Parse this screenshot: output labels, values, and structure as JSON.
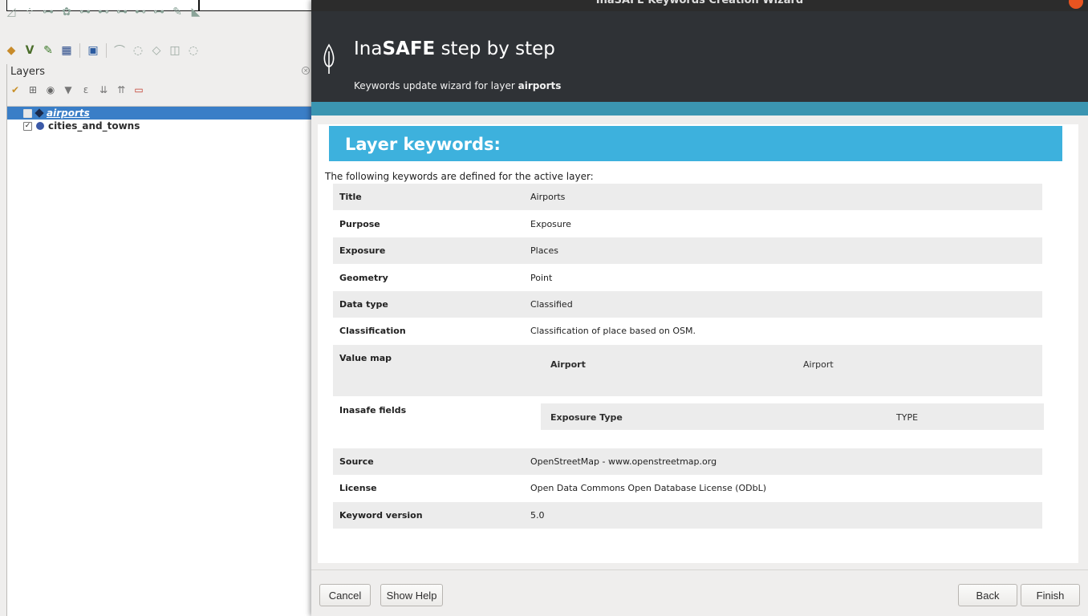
{
  "qgis": {
    "layers_panel": {
      "title": "Layers",
      "layers": [
        {
          "name": "airports",
          "checked": false,
          "selected": true,
          "symbol": "point-diamond"
        },
        {
          "name": "cities_and_towns",
          "checked": true,
          "selected": false,
          "symbol": "point-circle"
        }
      ]
    },
    "toolbar_row1_icons": [
      "digitize-icon",
      "node-tool-icon",
      "add-feature-icon",
      "vertex-icon",
      "move-icon",
      "rotate-icon",
      "split-icon",
      "merge-icon",
      "reshape-icon",
      "offset-icon",
      "edit-icon"
    ],
    "toolbar_row2_icons": [
      "layer-style-icon",
      "vertex-tool-icon",
      "pen-icon",
      "plugin-icon",
      "processing-icon",
      "curve-icon",
      "bezier-icon",
      "shape-icon",
      "select-icon",
      "extra-icon"
    ]
  },
  "dialog": {
    "window_title": "InaSAFE Keywords Creation Wizard",
    "header": {
      "title_prefix": "Ina",
      "title_bold": "SAFE",
      "title_suffix": " step by step",
      "subtitle_prefix": "Keywords update wizard for layer ",
      "subtitle_layer": "airports"
    },
    "section_title": "Layer keywords:",
    "intro": "The following keywords are defined for the active layer:",
    "keywords": [
      {
        "key": "Title",
        "value": "Airports"
      },
      {
        "key": "Purpose",
        "value": "Exposure"
      },
      {
        "key": "Exposure",
        "value": "Places"
      },
      {
        "key": "Geometry",
        "value": "Point"
      },
      {
        "key": "Data type",
        "value": "Classified"
      },
      {
        "key": "Classification",
        "value": "Classification of place based on OSM."
      }
    ],
    "value_map": {
      "key": "Value map",
      "class_name": "Airport",
      "class_value": "Airport"
    },
    "inasafe_fields": {
      "key": "Inasafe fields",
      "field_name": "Exposure Type",
      "field_value": "TYPE"
    },
    "keywords_tail": [
      {
        "key": "Source",
        "value": "OpenStreetMap - www.openstreetmap.org"
      },
      {
        "key": "License",
        "value": "Open Data Commons Open Database License (ODbL)"
      },
      {
        "key": "Keyword version",
        "value": "5.0"
      }
    ],
    "buttons": {
      "cancel": "Cancel",
      "help": "Show Help",
      "back": "Back",
      "finish": "Finish"
    },
    "colors": {
      "header_bg": "#2f3236",
      "stripe": "#3b95b1",
      "section_bar": "#3db1dd",
      "close_button": "#e95420"
    }
  }
}
